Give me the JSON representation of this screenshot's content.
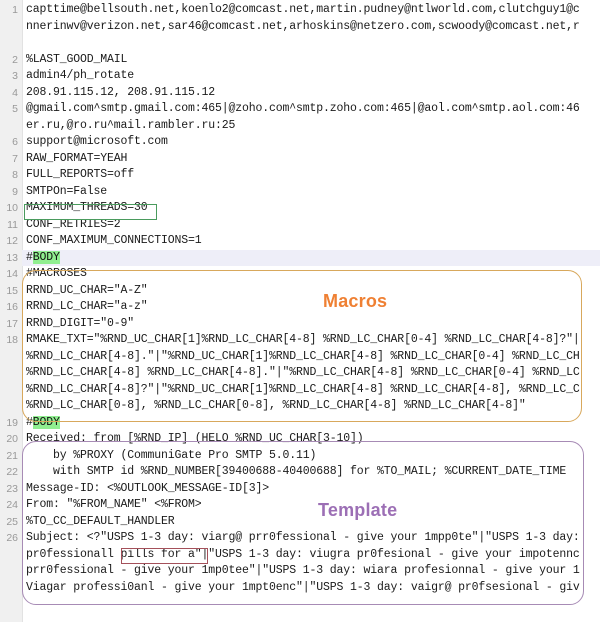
{
  "editor": {
    "gutter_color": "#f0f0f0",
    "text_color": "#1a1a1a",
    "line_number_color": "#999999"
  },
  "annotations": [
    {
      "label": "Macros",
      "color": "#ef8033",
      "box_color": "#d8a85c"
    },
    {
      "label": "Template",
      "color": "#9c6fb5",
      "box_color": "#a78bb5"
    }
  ],
  "highlights": {
    "green_box_target": "MAXIMUM_THREADS=30",
    "green_box_color": "#4a9b5d",
    "red_box_target": "USPS 1-3 day:",
    "red_box_color": "#a4505a",
    "keyword_highlight_color": "#90ee90",
    "row_highlight_color": "#eeeef8"
  },
  "lines": [
    {
      "n": "1",
      "text": "capttime@bellsouth.net,koenlo2@comcast.net,martin.pudney@ntlworld.com,clutchguy1@c"
    },
    {
      "n": "",
      "text": "nnerinwv@verizon.net,sar46@comcast.net,arhoskins@netzero.com,scwoody@comcast.net,r"
    },
    {
      "n": "",
      "text": ""
    },
    {
      "n": "2",
      "text": "%LAST_GOOD_MAIL"
    },
    {
      "n": "3",
      "text": "admin4/ph_rotate"
    },
    {
      "n": "4",
      "text": "208.91.115.12, 208.91.115.12"
    },
    {
      "n": "5",
      "text": "@gmail.com^smtp.gmail.com:465|@zoho.com^smtp.zoho.com:465|@aol.com^smtp.aol.com:46"
    },
    {
      "n": "",
      "text": "er.ru,@ro.ru^mail.rambler.ru:25"
    },
    {
      "n": "6",
      "text": "support@microsoft.com"
    },
    {
      "n": "7",
      "text": "RAW_FORMAT=YEAH"
    },
    {
      "n": "8",
      "text": "FULL_REPORTS=off"
    },
    {
      "n": "9",
      "text": "SMTPOn=False"
    },
    {
      "n": "10",
      "text": "MAXIMUM_THREADS=30"
    },
    {
      "n": "11",
      "text": "CONF_RETRIES=2"
    },
    {
      "n": "12",
      "text": "CONF_MAXIMUM_CONNECTIONS=1"
    },
    {
      "n": "13",
      "text": "#BODY",
      "hl_row": true,
      "kw": "BODY"
    },
    {
      "n": "14",
      "text": "#MACROSES"
    },
    {
      "n": "15",
      "text": "RRND_UC_CHAR=\"A-Z\""
    },
    {
      "n": "16",
      "text": "RRND_LC_CHAR=\"a-z\""
    },
    {
      "n": "17",
      "text": "RRND_DIGIT=\"0-9\""
    },
    {
      "n": "18",
      "text": "RMAKE_TXT=\"%RND_UC_CHAR[1]%RND_LC_CHAR[4-8] %RND_LC_CHAR[0-4] %RND_LC_CHAR[4-8]?\"|"
    },
    {
      "n": "",
      "text": "%RND_LC_CHAR[4-8].\"|\"%RND_UC_CHAR[1]%RND_LC_CHAR[4-8] %RND_LC_CHAR[0-4] %RND_LC_CH"
    },
    {
      "n": "",
      "text": "%RND_LC_CHAR[4-8] %RND_LC_CHAR[4-8].\"|\"%RND_LC_CHAR[4-8] %RND_LC_CHAR[0-4] %RND_LC"
    },
    {
      "n": "",
      "text": "%RND_LC_CHAR[4-8]?\"|\"%RND_UC_CHAR[1]%RND_LC_CHAR[4-8] %RND_LC_CHAR[4-8], %RND_LC_C"
    },
    {
      "n": "",
      "text": "%RND_LC_CHAR[0-8], %RND_LC_CHAR[0-8], %RND_LC_CHAR[4-8] %RND_LC_CHAR[4-8]\""
    },
    {
      "n": "19",
      "text": "#BODY",
      "kw": "BODY"
    },
    {
      "n": "20",
      "text": "Received: from [%RND_IP] (HELO %RND_UC_CHAR[3-10])"
    },
    {
      "n": "21",
      "text": "    by %PROXY (CommuniGate Pro SMTP 5.0.11)"
    },
    {
      "n": "22",
      "text": "    with SMTP id %RND_NUMBER[39400688-40400688] for %TO_MAIL; %CURRENT_DATE_TIME"
    },
    {
      "n": "23",
      "text": "Message-ID: <%OUTLOOK_MESSAGE-ID[3]>"
    },
    {
      "n": "24",
      "text": "From: \"%FROM_NAME\" <%FROM>"
    },
    {
      "n": "25",
      "text": "%TO_CC_DEFAULT_HANDLER"
    },
    {
      "n": "26",
      "text": "Subject: <?\"USPS 1-3 day: viarg@ prr0fessional - give your 1mpp0te\"|\"USPS 1-3 day:"
    },
    {
      "n": "",
      "text": "pr0fessionall pills for a\"|\"USPS 1-3 day: viugra pr0fesional - give your impotennc"
    },
    {
      "n": "",
      "text": "prr0fessional - give your 1mp0tee\"|\"USPS 1-3 day: wiara profesionnal - give your 1"
    },
    {
      "n": "",
      "text": "Viagar professi0anl - give your 1mpt0enc\"|\"USPS 1-3 day: vaigr@ pr0fsesional - giv"
    }
  ]
}
